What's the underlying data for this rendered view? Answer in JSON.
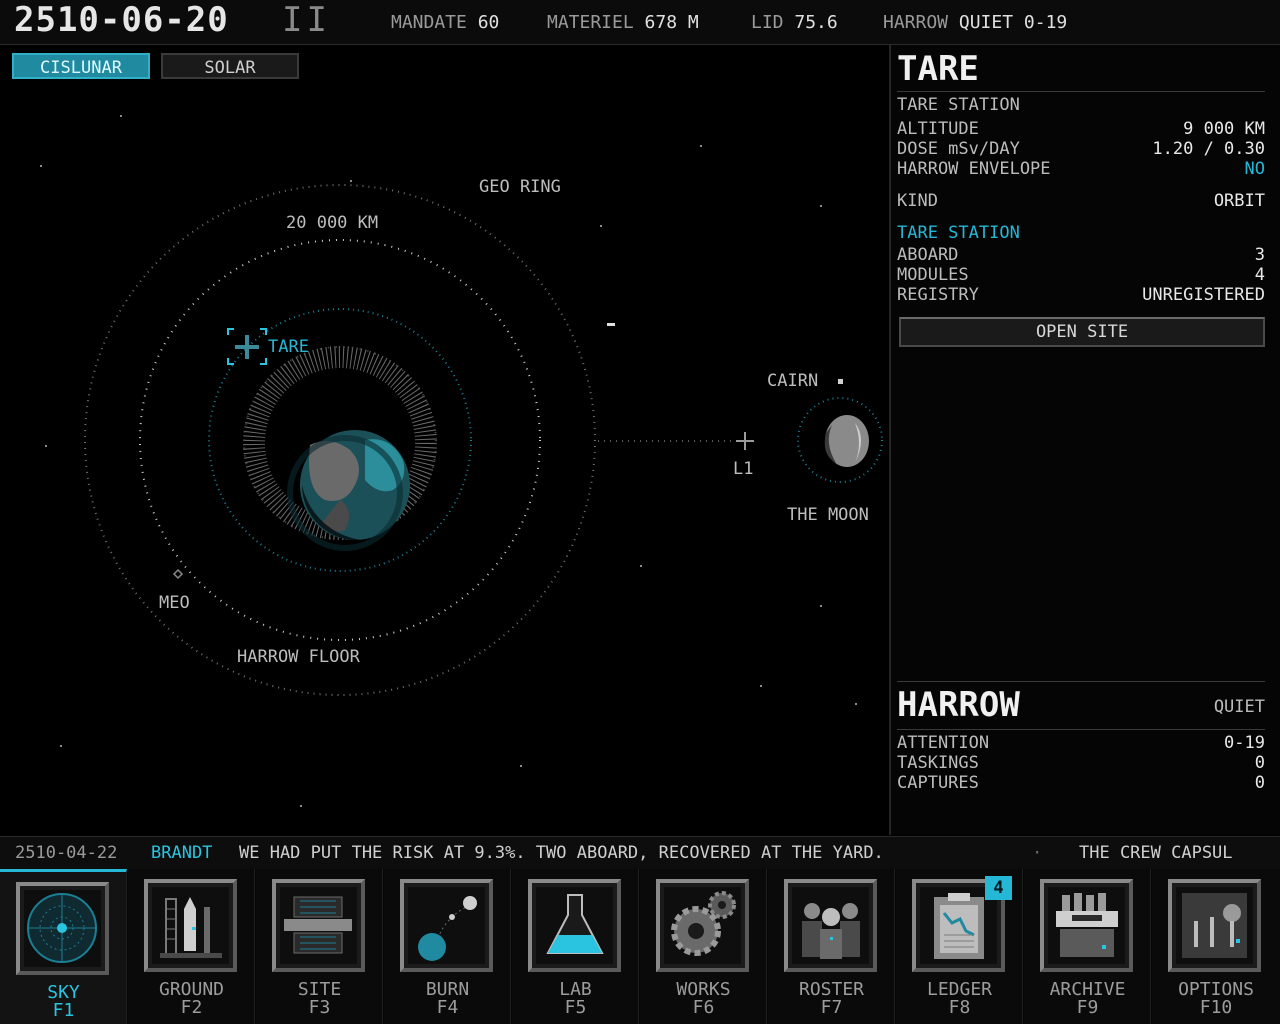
{
  "topbar": {
    "date": "2510-06-20",
    "speed": "II",
    "mandate_label": "MANDATE",
    "mandate_value": "60",
    "materiel_label": "MATERIEL",
    "materiel_value": "678 M",
    "lid_label": "LID",
    "lid_value": "75.6",
    "harrow_label": "HARROW",
    "harrow_value": "QUIET 0-19"
  },
  "map": {
    "toggles": {
      "cislunar": "CISLUNAR",
      "solar": "SOLAR"
    },
    "labels": {
      "geo_ring": "GEO RING",
      "km": "20 000 KM",
      "tare": "TARE",
      "cairn": "CAIRN",
      "l1": "L1",
      "moon": "THE MOON",
      "meo": "MEO",
      "harrow_floor": "HARROW FLOOR"
    }
  },
  "panel": {
    "title": "TARE",
    "subtitle": "TARE STATION",
    "rows1": [
      {
        "label": "ALTITUDE",
        "value": "9 000 KM"
      },
      {
        "label": "DOSE mSv/DAY",
        "value": "1.20 / 0.30"
      },
      {
        "label": "HARROW ENVELOPE",
        "value": "NO"
      }
    ],
    "kind_label": "KIND",
    "kind_value": "ORBIT",
    "station_heading": "TARE STATION",
    "rows2": [
      {
        "label": "ABOARD",
        "value": "3"
      },
      {
        "label": "MODULES",
        "value": "4"
      },
      {
        "label": "REGISTRY",
        "value": "UNREGISTERED"
      }
    ],
    "open_site": "OPEN SITE",
    "harrow_title": "HARROW",
    "harrow_state": "QUIET",
    "rows3": [
      {
        "label": "ATTENTION",
        "value": "0-19"
      },
      {
        "label": "TASKINGS",
        "value": "0"
      },
      {
        "label": "CAPTURES",
        "value": "0"
      }
    ]
  },
  "ticker": {
    "date": "2510-04-22",
    "name": "BRANDT",
    "message": "WE HAD PUT THE RISK AT 9.3%. TWO ABOARD, RECOVERED AT THE YARD.",
    "sep": "·",
    "next": "THE CREW CAPSUL"
  },
  "tabs": [
    {
      "label": "SKY",
      "key": "F1"
    },
    {
      "label": "GROUND",
      "key": "F2"
    },
    {
      "label": "SITE",
      "key": "F3"
    },
    {
      "label": "BURN",
      "key": "F4"
    },
    {
      "label": "LAB",
      "key": "F5"
    },
    {
      "label": "WORKS",
      "key": "F6"
    },
    {
      "label": "ROSTER",
      "key": "F7"
    },
    {
      "label": "LEDGER",
      "key": "F8"
    },
    {
      "label": "ARCHIVE",
      "key": "F9"
    },
    {
      "label": "OPTIONS",
      "key": "F10"
    }
  ],
  "ledger_badge": "4",
  "colors": {
    "accent": "#25b8d6",
    "background": "#000000",
    "panel": "#050505"
  }
}
